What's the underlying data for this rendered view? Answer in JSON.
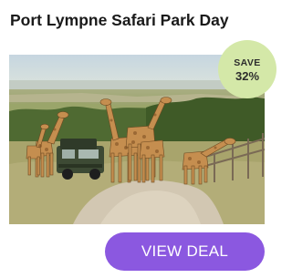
{
  "deal": {
    "title": "Port Lympne Safari Park Day",
    "image_alt": "Giraffes surrounding a safari truck on a dirt track",
    "badge": {
      "label": "SAVE",
      "value": "32%"
    },
    "cta_label": "VIEW DEAL"
  },
  "colors": {
    "badge_bg": "#d4e8a8",
    "cta_bg": "#8b58e0",
    "title_text": "#1a1a1a"
  }
}
